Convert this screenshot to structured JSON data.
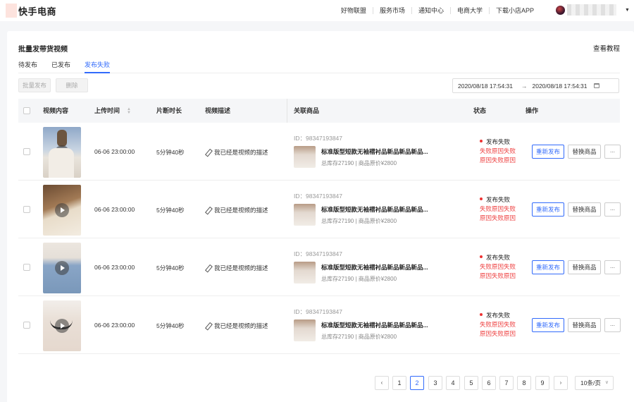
{
  "header": {
    "logo_text": "快手电商",
    "nav": [
      "好物联盟",
      "服务市场",
      "通知中心",
      "电商大学",
      "下载小店APP"
    ]
  },
  "page": {
    "title": "批量发带货视频",
    "help_link": "查看教程",
    "tabs": [
      {
        "label": "待发布",
        "active": false
      },
      {
        "label": "已发布",
        "active": false
      },
      {
        "label": "发布失败",
        "active": true
      }
    ],
    "batch_publish_label": "批量发布",
    "delete_label": "删除",
    "date_start": "2020/08/18 17:54:31",
    "date_end": "2020/08/18 17:54:31",
    "date_arrow": "→"
  },
  "table": {
    "columns": [
      "视频内容",
      "上传时间",
      "片断时长",
      "视频描述",
      "关联商品",
      "状态",
      "操作"
    ],
    "rows": [
      {
        "upload_time": "06-06 23:00:00",
        "duration": "5分钟40秒",
        "description": "我已经是视频的描述",
        "product_id": "ID：98347193847",
        "product_name": "标准版型短款无袖褶衬品新品新品新品...",
        "product_meta": "总库存27190 | 商品原价¥2800",
        "status": "发布失败",
        "reason": "失败原因失败原因失败原因",
        "action_republish": "重新发布",
        "action_replace": "替换商品",
        "action_more": "..."
      },
      {
        "upload_time": "06-06 23:00:00",
        "duration": "5分钟40秒",
        "description": "我已经是视频的描述",
        "product_id": "ID：98347193847",
        "product_name": "标准版型短款无袖褶衬品新品新品新品...",
        "product_meta": "总库存27190 | 商品原价¥2800",
        "status": "发布失败",
        "reason": "失败原因失败原因失败原因",
        "action_republish": "重新发布",
        "action_replace": "替换商品",
        "action_more": "..."
      },
      {
        "upload_time": "06-06 23:00:00",
        "duration": "5分钟40秒",
        "description": "我已经是视频的描述",
        "product_id": "ID：98347193847",
        "product_name": "标准版型短款无袖褶衬品新品新品新品...",
        "product_meta": "总库存27190 | 商品原价¥2800",
        "status": "发布失败",
        "reason": "失败原因失败原因失败原因",
        "action_republish": "重新发布",
        "action_replace": "替换商品",
        "action_more": "..."
      },
      {
        "upload_time": "06-06 23:00:00",
        "duration": "5分钟40秒",
        "description": "我已经是视频的描述",
        "product_id": "ID：98347193847",
        "product_name": "标准版型短款无袖褶衬品新品新品新品...",
        "product_meta": "总库存27190 | 商品原价¥2800",
        "status": "发布失败",
        "reason": "失败原因失败原因失败原因",
        "action_republish": "重新发布",
        "action_replace": "替换商品",
        "action_more": "..."
      }
    ]
  },
  "pagination": {
    "prev": "‹",
    "next": "›",
    "pages": [
      "1",
      "2",
      "3",
      "4",
      "5",
      "6",
      "7",
      "8",
      "9"
    ],
    "current": "2",
    "page_size": "10条/页"
  },
  "colors": {
    "accent": "#326bfb",
    "error": "#ee4141"
  },
  "icons": {
    "sort": "sort-icon",
    "edit": "edit-icon",
    "play": "play-icon",
    "calendar": "calendar-icon",
    "dropdown": "chevron-down-icon"
  }
}
